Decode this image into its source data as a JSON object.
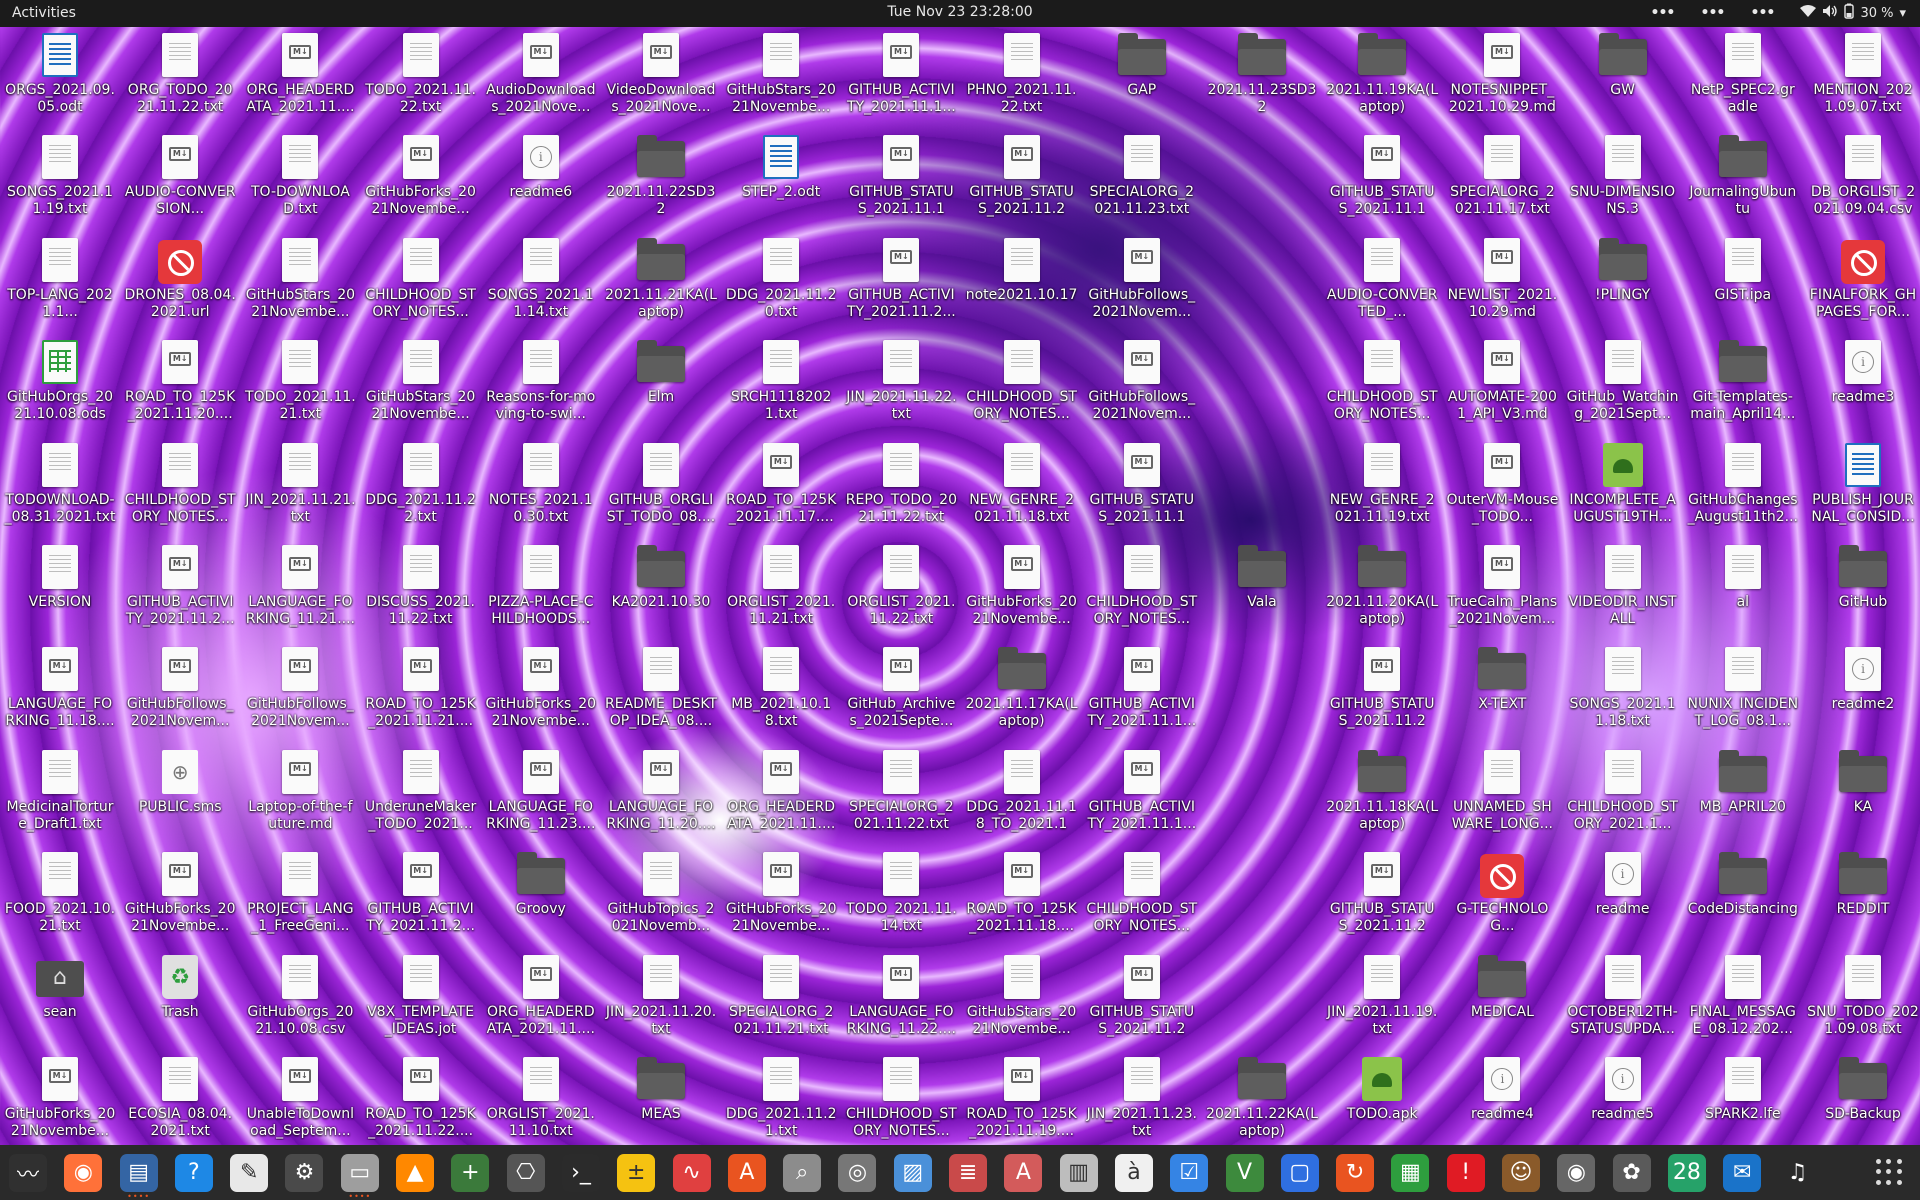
{
  "topbar": {
    "activities": "Activities",
    "clock": "Tue Nov 23  23:28:00",
    "battery": "30 %"
  },
  "desktop": {
    "columns": [
      [
        {
          "label": "ORGS_2021.09.05.odt",
          "icon": "odt"
        },
        {
          "label": "SONGS_2021.11.19.txt",
          "icon": "doc"
        },
        {
          "label": "TOP-LANG_2021.1...",
          "icon": "doc"
        },
        {
          "label": "GitHubOrgs_2021.10.08.ods",
          "icon": "ods"
        },
        {
          "label": "TODOWNLOAD-_08.31.2021.txt",
          "icon": "doc"
        },
        {
          "label": "VERSION",
          "icon": "doc"
        },
        {
          "label": "LANGUAGE_FORKING_11.18....",
          "icon": "md"
        },
        {
          "label": "MedicinalTorture_Draft1.txt",
          "icon": "doc"
        },
        {
          "label": "FOOD_2021.10.21.txt",
          "icon": "doc"
        },
        {
          "label": "sean",
          "icon": "home"
        },
        {
          "label": "GitHubForks_2021Novembe...",
          "icon": "md"
        }
      ],
      [
        {
          "label": "ORG_TODO_2021.11.22.txt",
          "icon": "doc"
        },
        {
          "label": "AUDIO-CONVERSION...",
          "icon": "md"
        },
        {
          "label": "DRONES_08.04.2021.url",
          "icon": "forbid"
        },
        {
          "label": "ROAD_TO_125K_2021.11.20....",
          "icon": "md"
        },
        {
          "label": "CHILDHOOD_STORY_NOTES...",
          "icon": "doc"
        },
        {
          "label": "GITHUB_ACTIVITY_2021.11.2...",
          "icon": "md"
        },
        {
          "label": "GitHubFollows_2021Novem...",
          "icon": "md"
        },
        {
          "label": "PUBLIC.sms",
          "icon": "game"
        },
        {
          "label": "GitHubForks_2021Novembe...",
          "icon": "md"
        },
        {
          "label": "Trash",
          "icon": "trash"
        },
        {
          "label": "ECOSIA_08.04.2021.txt",
          "icon": "doc"
        }
      ],
      [
        {
          "label": "ORG_HEADERDATA_2021.11....",
          "icon": "md"
        },
        {
          "label": "TO-DOWNLOAD.txt",
          "icon": "doc"
        },
        {
          "label": "GitHubStars_2021Novembe...",
          "icon": "doc"
        },
        {
          "label": "TODO_2021.11.21.txt",
          "icon": "doc"
        },
        {
          "label": "JIN_2021.11.21.txt",
          "icon": "doc"
        },
        {
          "label": "LANGUAGE_FORKING_11.21....",
          "icon": "md"
        },
        {
          "label": "GitHubFollows_2021Novem...",
          "icon": "md"
        },
        {
          "label": "Laptop-of-the-future.md",
          "icon": "md"
        },
        {
          "label": "PROJECT_LANG_1_FreeGeni...",
          "icon": "doc"
        },
        {
          "label": "GitHubOrgs_2021.10.08.csv",
          "icon": "doc"
        },
        {
          "label": "UnableToDownload_Septem...",
          "icon": "md"
        }
      ],
      [
        {
          "label": "TODO_2021.11.22.txt",
          "icon": "doc"
        },
        {
          "label": "GitHubForks_2021Novembe...",
          "icon": "md"
        },
        {
          "label": "CHILDHOOD_STORY_NOTES...",
          "icon": "doc"
        },
        {
          "label": "GitHubStars_2021Novembe...",
          "icon": "doc"
        },
        {
          "label": "DDG_2021.11.22.txt",
          "icon": "doc"
        },
        {
          "label": "DISCUSS_2021.11.22.txt",
          "icon": "doc"
        },
        {
          "label": "ROAD_TO_125K_2021.11.21....",
          "icon": "md"
        },
        {
          "label": "UnderuneMaker_TODO_2021...",
          "icon": "doc"
        },
        {
          "label": "GITHUB_ACTIVITY_2021.11.2...",
          "icon": "md"
        },
        {
          "label": "V8X_TEMPLATE_IDEAS.jot",
          "icon": "doc"
        },
        {
          "label": "ROAD_TO_125K_2021.11.22....",
          "icon": "md"
        }
      ],
      [
        {
          "label": "AudioDownloads_2021Nove...",
          "icon": "md"
        },
        {
          "label": "readme6",
          "icon": "info"
        },
        {
          "label": "SONGS_2021.11.14.txt",
          "icon": "doc"
        },
        {
          "label": "Reasons-for-moving-to-swi...",
          "icon": "doc"
        },
        {
          "label": "NOTES_2021.10.30.txt",
          "icon": "doc"
        },
        {
          "label": "PIZZA-PLACE-CHILDHOODS...",
          "icon": "doc"
        },
        {
          "label": "GitHubForks_2021Novembe...",
          "icon": "md"
        },
        {
          "label": "LANGUAGE_FORKING_11.23....",
          "icon": "md"
        },
        {
          "label": "Groovy",
          "icon": "folder"
        },
        {
          "label": "ORG_HEADERDATA_2021.11....",
          "icon": "md"
        },
        {
          "label": "ORGLIST_2021.11.10.txt",
          "icon": "doc"
        }
      ],
      [
        {
          "label": "VideoDownloads_2021Nove...",
          "icon": "md"
        },
        {
          "label": "2021.11.22SD32",
          "icon": "folder"
        },
        {
          "label": "2021.11.21KA(Laptop)",
          "icon": "folder"
        },
        {
          "label": "Elm",
          "icon": "folder"
        },
        {
          "label": "GITHUB_ORGLIST_TODO_08....",
          "icon": "doc"
        },
        {
          "label": "KA2021.10.30",
          "icon": "folder"
        },
        {
          "label": "README_DESKTOP_IDEA_08....",
          "icon": "doc"
        },
        {
          "label": "LANGUAGE_FORKING_11.20....",
          "icon": "md"
        },
        {
          "label": "GitHubTopics_2021Novemb...",
          "icon": "doc"
        },
        {
          "label": "JIN_2021.11.20.txt",
          "icon": "doc"
        },
        {
          "label": "MEAS",
          "icon": "folder"
        }
      ],
      [
        {
          "label": "GitHubStars_2021Novembe...",
          "icon": "doc"
        },
        {
          "label": "STEP_2.odt",
          "icon": "odt"
        },
        {
          "label": "DDG_2021.11.20.txt",
          "icon": "doc"
        },
        {
          "label": "SRCH11182021.txt",
          "icon": "doc"
        },
        {
          "label": "ROAD_TO_125K_2021.11.17....",
          "icon": "md"
        },
        {
          "label": "ORGLIST_2021.11.21.txt",
          "icon": "doc"
        },
        {
          "label": "MB_2021.10.18.txt",
          "icon": "doc"
        },
        {
          "label": "ORG_HEADERDATA_2021.11....",
          "icon": "md"
        },
        {
          "label": "GitHubForks_2021Novembe...",
          "icon": "md"
        },
        {
          "label": "SPECIALORG_2021.11.21.txt",
          "icon": "doc"
        },
        {
          "label": "DDG_2021.11.21.txt",
          "icon": "doc"
        }
      ],
      [
        {
          "label": "GITHUB_ACTIVITY_2021.11.1...",
          "icon": "md"
        },
        {
          "label": "GITHUB_STATUS_2021.11.17....",
          "icon": "md"
        },
        {
          "label": "GITHUB_ACTIVITY_2021.11.2...",
          "icon": "md"
        },
        {
          "label": "JIN_2021.11.22.txt",
          "icon": "doc"
        },
        {
          "label": "REPO_TODO_2021.11.22.txt",
          "icon": "doc"
        },
        {
          "label": "ORGLIST_2021.11.22.txt",
          "icon": "doc"
        },
        {
          "label": "GitHub_Archives_2021Septe...",
          "icon": "md"
        },
        {
          "label": "SPECIALORG_2021.11.22.txt",
          "icon": "doc"
        },
        {
          "label": "TODO_2021.11.14.txt",
          "icon": "doc"
        },
        {
          "label": "LANGUAGE_FORKING_11.22....",
          "icon": "md"
        },
        {
          "label": "CHILDHOOD_STORY_NOTES...",
          "icon": "doc"
        }
      ],
      [
        {
          "label": "PHNO_2021.11.22.txt",
          "icon": "doc"
        },
        {
          "label": "GITHUB_STATUS_2021.11.22....",
          "icon": "md"
        },
        {
          "label": "note2021.10.17",
          "icon": "doc"
        },
        {
          "label": "CHILDHOOD_STORY_NOTES...",
          "icon": "doc"
        },
        {
          "label": "NEW_GENRE_2021.11.18.txt",
          "icon": "doc"
        },
        {
          "label": "GitHubForks_2021Novembe...",
          "icon": "md"
        },
        {
          "label": "2021.11.17KA(Laptop)",
          "icon": "folder"
        },
        {
          "label": "DDG_2021.11.18_TO_2021.11...",
          "icon": "doc"
        },
        {
          "label": "ROAD_TO_125K_2021.11.18....",
          "icon": "md"
        },
        {
          "label": "GitHubStars_2021Novembe...",
          "icon": "doc"
        },
        {
          "label": "ROAD_TO_125K_2021.11.19....",
          "icon": "md"
        }
      ],
      [
        {
          "label": "GAP",
          "icon": "folder"
        },
        {
          "label": "SPECIALORG_2021.11.23.txt",
          "icon": "doc"
        },
        {
          "label": "GitHubFollows_2021Novem...",
          "icon": "md"
        },
        {
          "label": "GitHubFollows_2021Novem...",
          "icon": "md"
        },
        {
          "label": "GITHUB_STATUS_2021.11.19....",
          "icon": "md"
        },
        {
          "label": "CHILDHOOD_STORY_NOTES...",
          "icon": "doc"
        },
        {
          "label": "GITHUB_ACTIVITY_2021.11.1...",
          "icon": "md"
        },
        {
          "label": "GITHUB_ACTIVITY_2021.11.1...",
          "icon": "md"
        },
        {
          "label": "CHILDHOOD_STORY_NOTES...",
          "icon": "doc"
        },
        {
          "label": "GITHUB_STATUS_2021.11.23....",
          "icon": "md"
        },
        {
          "label": "JIN_2021.11.23.txt",
          "icon": "doc"
        }
      ],
      [
        {
          "label": "2021.11.23SD32",
          "icon": "folder"
        },
        {
          "label": "",
          "icon": "none"
        },
        {
          "label": "",
          "icon": "none"
        },
        {
          "label": "",
          "icon": "none"
        },
        {
          "label": "",
          "icon": "none"
        },
        {
          "label": "Vala",
          "icon": "folder"
        },
        {
          "label": "",
          "icon": "none"
        },
        {
          "label": "",
          "icon": "none"
        },
        {
          "label": "",
          "icon": "none"
        },
        {
          "label": "",
          "icon": "none"
        },
        {
          "label": "2021.11.22KA(Laptop)",
          "icon": "folder"
        }
      ],
      [
        {
          "label": "2021.11.19KA(Laptop)",
          "icon": "folder"
        },
        {
          "label": "GITHUB_STATUS_2021.11.18....",
          "icon": "md"
        },
        {
          "label": "AUDIO-CONVERTED_...",
          "icon": "doc"
        },
        {
          "label": "CHILDHOOD_STORY_NOTES...",
          "icon": "doc"
        },
        {
          "label": "NEW_GENRE_2021.11.19.txt",
          "icon": "doc"
        },
        {
          "label": "2021.11.20KA(Laptop)",
          "icon": "folder"
        },
        {
          "label": "GITHUB_STATUS_2021.11.20....",
          "icon": "md"
        },
        {
          "label": "2021.11.18KA(Laptop)",
          "icon": "folder"
        },
        {
          "label": "GITHUB_STATUS_2021.11.21....",
          "icon": "md"
        },
        {
          "label": "JIN_2021.11.19.txt",
          "icon": "doc"
        },
        {
          "label": "TODO.apk",
          "icon": "apk"
        }
      ],
      [
        {
          "label": "NOTESNIPPET_2021.10.29.md",
          "icon": "md"
        },
        {
          "label": "SPECIALORG_2021.11.17.txt",
          "icon": "doc"
        },
        {
          "label": "NEWLIST_2021.10.29.md",
          "icon": "md"
        },
        {
          "label": "AUTOMATE-2001_API_V3.md",
          "icon": "md"
        },
        {
          "label": "OuterVM-Mouse_TODO...",
          "icon": "md"
        },
        {
          "label": "TrueCalm_Plans_2021Novem...",
          "icon": "md"
        },
        {
          "label": "X-TEXT",
          "icon": "folder"
        },
        {
          "label": "UNNAMED_SHWARE_LONG...",
          "icon": "doc"
        },
        {
          "label": "G-TECHNOLOG...",
          "icon": "forbid"
        },
        {
          "label": "MEDICAL",
          "icon": "folder"
        },
        {
          "label": "readme4",
          "icon": "info"
        }
      ],
      [
        {
          "label": "GW",
          "icon": "folder"
        },
        {
          "label": "SNU-DIMENSIONS.3",
          "icon": "doc"
        },
        {
          "label": "!PLINGY",
          "icon": "folder"
        },
        {
          "label": "GitHub_Watching_2021Sept...",
          "icon": "doc"
        },
        {
          "label": "INCOMPLETE_AUGUST19TH...",
          "icon": "apk"
        },
        {
          "label": "VIDEODIR_INSTALL",
          "icon": "doc"
        },
        {
          "label": "SONGS_2021.11.18.txt",
          "icon": "doc"
        },
        {
          "label": "CHILDHOOD_STORY_2021.1...",
          "icon": "doc"
        },
        {
          "label": "readme",
          "icon": "info"
        },
        {
          "label": "OCTOBER12TH-STATUSUPDA...",
          "icon": "doc"
        },
        {
          "label": "readme5",
          "icon": "info"
        }
      ],
      [
        {
          "label": "NetP_SPEC2.gradle",
          "icon": "doc"
        },
        {
          "label": "JournalingUbuntu",
          "icon": "folder"
        },
        {
          "label": "GIST.ipa",
          "icon": "doc"
        },
        {
          "label": "Git-Templates-main_April14...",
          "icon": "folder"
        },
        {
          "label": "GitHubChanges_August11th2...",
          "icon": "doc"
        },
        {
          "label": "al",
          "icon": "doc"
        },
        {
          "label": "NUNIX_INCIDENT_LOG_08.1...",
          "icon": "doc"
        },
        {
          "label": "MB_APRIL20",
          "icon": "folder"
        },
        {
          "label": "CodeDistancing",
          "icon": "folder"
        },
        {
          "label": "FINAL_MESSAGE_08.12.202...",
          "icon": "doc"
        },
        {
          "label": "SPARK2.lfe",
          "icon": "doc"
        }
      ],
      [
        {
          "label": "MENTION_2021.09.07.txt",
          "icon": "doc"
        },
        {
          "label": "DB_ORGLIST_2021.09.04.csv",
          "icon": "doc"
        },
        {
          "label": "FINALFORK_GHPAGES_FOR...",
          "icon": "forbid"
        },
        {
          "label": "readme3",
          "icon": "info"
        },
        {
          "label": "PUBLISH_JOURNAL_CONSID...",
          "icon": "odt"
        },
        {
          "label": "GitHub",
          "icon": "folder"
        },
        {
          "label": "readme2",
          "icon": "info"
        },
        {
          "label": "KA",
          "icon": "folder"
        },
        {
          "label": "REDDIT",
          "icon": "folder"
        },
        {
          "label": "SNU_TODO_2021.09.08.txt",
          "icon": "doc"
        },
        {
          "label": "SD-Backup",
          "icon": "folder"
        }
      ]
    ]
  },
  "dock": {
    "apps": [
      {
        "name": "system-monitor-icon",
        "glyph": "〰",
        "bg": "#303030",
        "running": false
      },
      {
        "name": "firefox-icon",
        "glyph": "◉",
        "bg": "#ff7139",
        "running": false
      },
      {
        "name": "text-editor-icon",
        "glyph": "▤",
        "bg": "#3465a4",
        "running": true
      },
      {
        "name": "help-icon",
        "glyph": "?",
        "bg": "#1e88e5",
        "running": false
      },
      {
        "name": "notes-icon",
        "glyph": "✎",
        "bg": "#e8e8e8",
        "running": false
      },
      {
        "name": "settings-icon",
        "glyph": "⚙",
        "bg": "#4a4a4a",
        "running": false
      },
      {
        "name": "files-icon",
        "glyph": "▭",
        "bg": "#9e9e9e",
        "running": true
      },
      {
        "name": "vlc-icon",
        "glyph": "▲",
        "bg": "#ff8800",
        "running": false
      },
      {
        "name": "calculator-icon",
        "glyph": "+",
        "bg": "#3b7a3b",
        "running": false
      },
      {
        "name": "software-icon",
        "glyph": "⎔",
        "bg": "#555555",
        "running": false
      },
      {
        "name": "terminal-icon",
        "glyph": "›_",
        "bg": "#2b2b2b",
        "running": false
      },
      {
        "name": "calc-icon",
        "glyph": "±",
        "bg": "#f5c211",
        "running": false
      },
      {
        "name": "graph-icon",
        "glyph": "∿",
        "bg": "#e04040",
        "running": false
      },
      {
        "name": "app-store-icon",
        "glyph": "A",
        "bg": "#e95420",
        "running": false
      },
      {
        "name": "search-tool-icon",
        "glyph": "⌕",
        "bg": "#8c8c8c",
        "running": false
      },
      {
        "name": "disk-icon",
        "glyph": "◎",
        "bg": "#777777",
        "running": false
      },
      {
        "name": "image-viewer-icon",
        "glyph": "▨",
        "bg": "#4a90d9",
        "running": false
      },
      {
        "name": "document-scanner-icon",
        "glyph": "≣",
        "bg": "#c94a4a",
        "running": false
      },
      {
        "name": "font-viewer-icon",
        "glyph": "A",
        "bg": "#d35b5b",
        "running": false
      },
      {
        "name": "archive-icon",
        "glyph": "▥",
        "bg": "#bdbdbd",
        "running": false
      },
      {
        "name": "characters-icon",
        "glyph": "à",
        "bg": "#f0f0f0",
        "running": false
      },
      {
        "name": "tasks-icon",
        "glyph": "☑",
        "bg": "#3584e4",
        "running": false
      },
      {
        "name": "vim-icon",
        "glyph": "V",
        "bg": "#3d8a3d",
        "running": false
      },
      {
        "name": "chat-icon",
        "glyph": "▢",
        "bg": "#2f6fe0",
        "running": false
      },
      {
        "name": "update-icon",
        "glyph": "↻",
        "bg": "#e95420",
        "running": false
      },
      {
        "name": "spreadsheet-icon",
        "glyph": "▦",
        "bg": "#2e9e3e",
        "running": false
      },
      {
        "name": "alert-icon",
        "glyph": "!",
        "bg": "#e01b24",
        "running": false
      },
      {
        "name": "game-icon",
        "glyph": "☺",
        "bg": "#8a5a2a",
        "running": false
      },
      {
        "name": "camera-icon",
        "glyph": "◉",
        "bg": "#666666",
        "running": false
      },
      {
        "name": "gimp-icon",
        "glyph": "✿",
        "bg": "#5a5a5a",
        "running": false
      },
      {
        "name": "calendar-icon",
        "glyph": "28",
        "bg": "#26a269",
        "running": false
      },
      {
        "name": "thunderbird-icon",
        "glyph": "✉",
        "bg": "#1a73c9",
        "running": false
      },
      {
        "name": "music-icon",
        "glyph": "♫",
        "bg": "#2a2a2a",
        "running": false
      }
    ]
  }
}
